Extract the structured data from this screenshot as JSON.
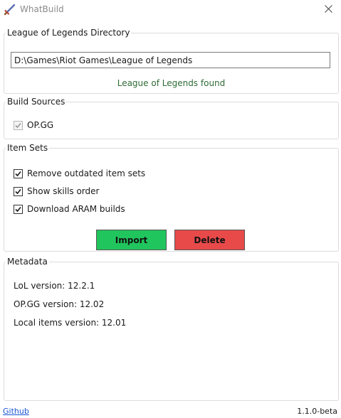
{
  "window": {
    "title": "WhatBuild",
    "icon": "sword-icon",
    "accent": "#21c55d"
  },
  "directory": {
    "legend": "League of Legends Directory",
    "path": "D:\\Games\\Riot Games\\League of Legends",
    "status": "League of Legends found",
    "status_color": "#2e6b34"
  },
  "build_sources": {
    "legend": "Build Sources",
    "items": [
      {
        "label": "OP.GG",
        "checked": true,
        "disabled": true
      }
    ]
  },
  "item_sets": {
    "legend": "Item Sets",
    "options": [
      {
        "label": "Remove outdated item sets",
        "checked": true
      },
      {
        "label": "Show skills order",
        "checked": true
      },
      {
        "label": "Download ARAM builds",
        "checked": true
      }
    ],
    "import_label": "Import",
    "delete_label": "Delete",
    "import_color": "#21c55d",
    "delete_color": "#e84a4a"
  },
  "metadata": {
    "legend": "Metadata",
    "lines": [
      "LoL version: 12.2.1",
      "OP.GG version: 12.02",
      "Local items version: 12.01"
    ]
  },
  "footer": {
    "link": "Github",
    "version": "1.1.0-beta"
  }
}
